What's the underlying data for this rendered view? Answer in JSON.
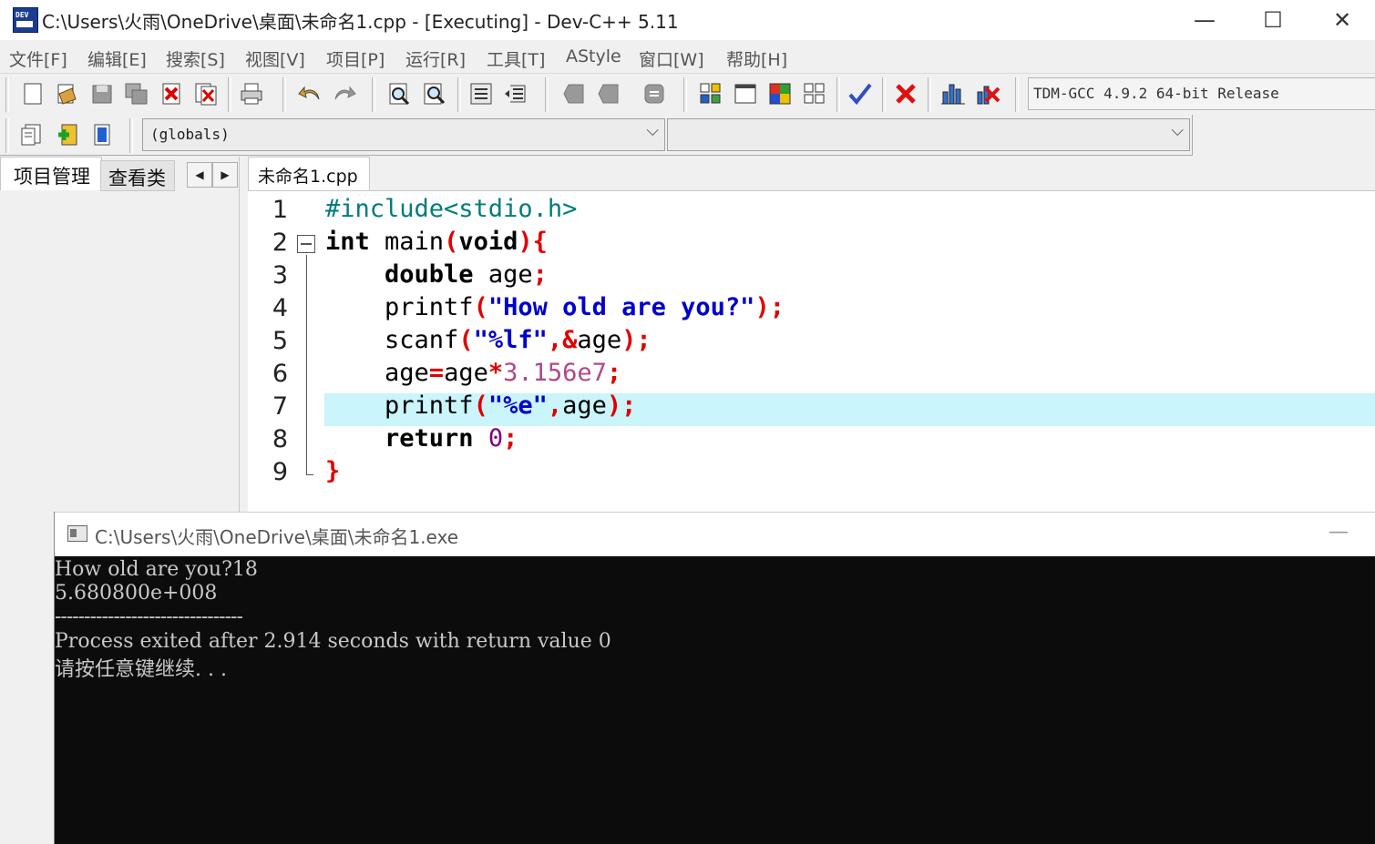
{
  "window": {
    "title": "C:\\Users\\火雨\\OneDrive\\桌面\\未命名1.cpp - [Executing] - Dev-C++ 5.11",
    "app_icon_label": "DEV",
    "min_glyph": "—",
    "max_glyph": "☐",
    "close_glyph": "✕"
  },
  "menu": [
    "文件[F]",
    "编辑[E]",
    "搜索[S]",
    "视图[V]",
    "项目[P]",
    "运行[R]",
    "工具[T]",
    "AStyle",
    "窗口[W]",
    "帮助[H]"
  ],
  "toolbar": {
    "icons": [
      "new-file-icon",
      "open-file-icon",
      "save-icon",
      "save-all-icon",
      "close-file-icon",
      "close-all-icon",
      "print-icon",
      "undo-icon",
      "redo-icon",
      "find-icon",
      "replace-icon",
      "indent-icon",
      "unindent-icon",
      "bookmark-back-icon",
      "bookmark-forward-icon",
      "goto-line-icon",
      "new-project-icon",
      "window-icon",
      "palette-icon",
      "grid-icon",
      "check-syntax-icon",
      "stop-icon",
      "chart-icon",
      "debug-stop-icon"
    ],
    "compiler": "TDM-GCC 4.9.2 64-bit Release"
  },
  "toolbar2": {
    "scope_value": "(globals)",
    "symbol_value": "",
    "arrow": "⌵"
  },
  "left_panel": {
    "tabs": [
      "项目管理",
      "查看类"
    ],
    "scroll_left": "◀",
    "scroll_right": "▶"
  },
  "editor": {
    "tab_label": "未命名1.cpp",
    "highlighted_line": 7,
    "line_numbers": [
      "1",
      "2",
      "3",
      "4",
      "5",
      "6",
      "7",
      "8",
      "9"
    ],
    "lines": [
      [
        {
          "t": "#include<stdio.h>",
          "c": "pp"
        }
      ],
      [
        {
          "t": "int",
          "c": "kw"
        },
        {
          "t": " main",
          "c": ""
        },
        {
          "t": "(",
          "c": "sym"
        },
        {
          "t": "void",
          "c": "kw"
        },
        {
          "t": "){",
          "c": "sym"
        }
      ],
      [
        {
          "t": "    ",
          "c": ""
        },
        {
          "t": "double",
          "c": "kw"
        },
        {
          "t": " age",
          "c": ""
        },
        {
          "t": ";",
          "c": "sym"
        }
      ],
      [
        {
          "t": "    printf",
          "c": ""
        },
        {
          "t": "(",
          "c": "sym"
        },
        {
          "t": "\"How old are you?\"",
          "c": "str"
        },
        {
          "t": ");",
          "c": "sym"
        }
      ],
      [
        {
          "t": "    scanf",
          "c": ""
        },
        {
          "t": "(",
          "c": "sym"
        },
        {
          "t": "\"%lf\"",
          "c": "str"
        },
        {
          "t": ",&",
          "c": "sym"
        },
        {
          "t": "age",
          "c": ""
        },
        {
          "t": ");",
          "c": "sym"
        }
      ],
      [
        {
          "t": "    age",
          "c": ""
        },
        {
          "t": "=",
          "c": "sym"
        },
        {
          "t": "age",
          "c": ""
        },
        {
          "t": "*",
          "c": "sym"
        },
        {
          "t": "3.156e7",
          "c": "num2"
        },
        {
          "t": ";",
          "c": "sym"
        }
      ],
      [
        {
          "t": "    printf",
          "c": ""
        },
        {
          "t": "(",
          "c": "sym"
        },
        {
          "t": "\"%e\"",
          "c": "str"
        },
        {
          "t": ",",
          "c": "sym"
        },
        {
          "t": "age",
          "c": ""
        },
        {
          "t": ");",
          "c": "sym"
        }
      ],
      [
        {
          "t": "    ",
          "c": ""
        },
        {
          "t": "return",
          "c": "kw"
        },
        {
          "t": " ",
          "c": ""
        },
        {
          "t": "0",
          "c": "num"
        },
        {
          "t": ";",
          "c": "sym"
        }
      ],
      [
        {
          "t": "}",
          "c": "sym"
        }
      ]
    ]
  },
  "console": {
    "title": "C:\\Users\\火雨\\OneDrive\\桌面\\未命名1.exe",
    "min_glyph": "—",
    "lines": [
      "How old are you?18",
      "5.680800e+008",
      "--------------------------------",
      "Process exited after 2.914 seconds with return value 0",
      "请按任意键继续. . ."
    ]
  },
  "colors": {
    "highlight": "#c9f5fb",
    "keyword": "#000000",
    "string": "#0000cc",
    "symbol": "#e00000",
    "number": "#800080",
    "console_bg": "#0c0c0c"
  }
}
